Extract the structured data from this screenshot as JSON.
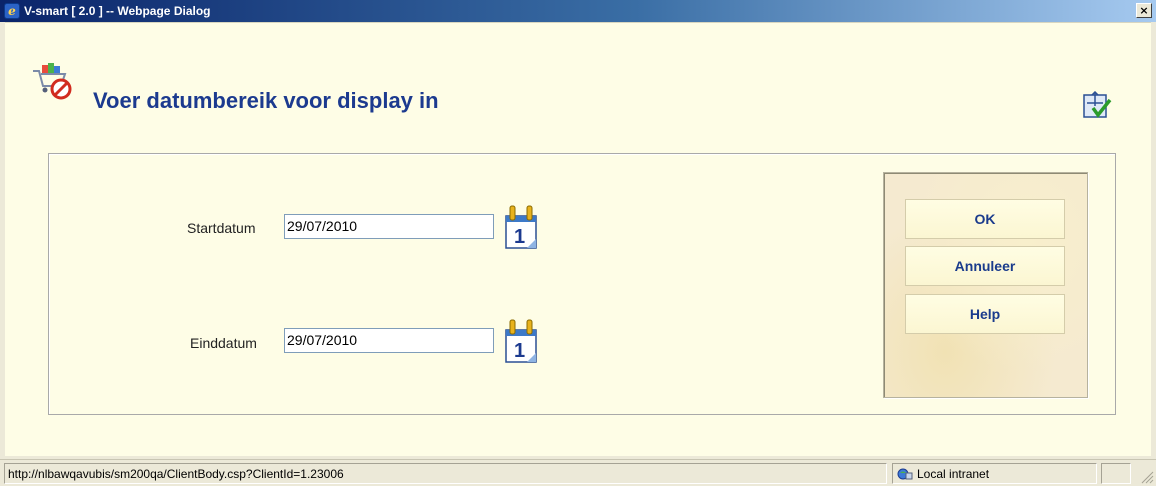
{
  "window": {
    "title": "V-smart [ 2.0 ] -- Webpage Dialog",
    "close_label": "×",
    "icon": "ie-icon"
  },
  "page": {
    "title": "Voer datumbereik voor display in",
    "header_icon": "shopping-cart-cancel-icon",
    "help_icon": "help-frame-icon"
  },
  "form": {
    "start_label": "Startdatum",
    "start_value": "29/07/2010",
    "end_label": "Einddatum",
    "end_value": "29/07/2010",
    "calendar_icon": "calendar-icon"
  },
  "buttons": {
    "ok": "OK",
    "cancel": "Annuleer",
    "help": "Help"
  },
  "statusbar": {
    "url": "http://nlbawqavubis/sm200qa/ClientBody.csp?ClientId=1.23006",
    "zone": "Local intranet"
  }
}
